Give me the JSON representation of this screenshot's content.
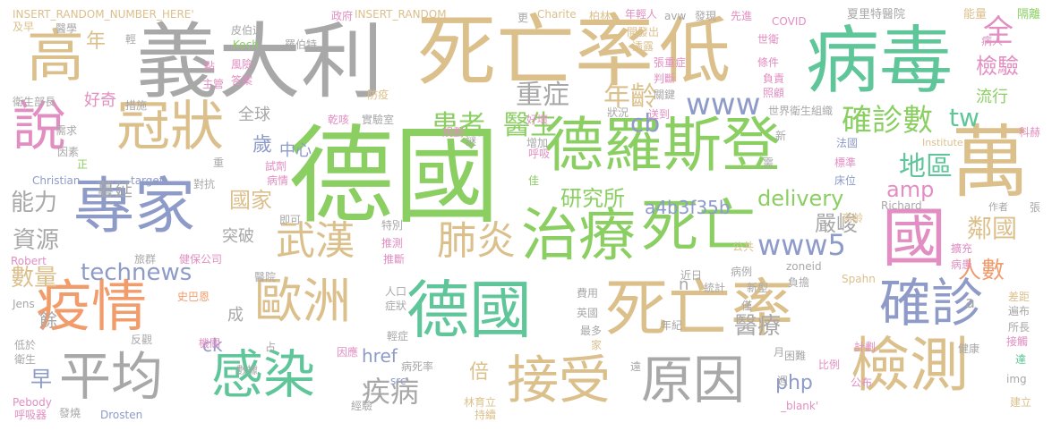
{
  "palette": {
    "green": "#8bcf63",
    "teal": "#5fc69a",
    "grey": "#a8a8a8",
    "tan": "#dcc08c",
    "pink": "#e28ec2",
    "slate": "#8e9bc9",
    "orange": "#f29b6b"
  },
  "words": [
    "德國",
    "義大利",
    "死亡率",
    "低",
    "病毒",
    "高",
    "說",
    "冠狀",
    "德羅斯登",
    "萬",
    "專家",
    "治療",
    "死亡",
    "國",
    "武漢",
    "肺炎",
    "疫情",
    "歐洲",
    "德國",
    "死亡率",
    "確診",
    "平均",
    "感染",
    "接受",
    "原因",
    "檢測",
    "technews",
    "www5",
    "delivery",
    "確診數",
    "重症",
    "年齡",
    "醫生",
    "患者",
    "www",
    "tw",
    "cb",
    "全",
    "檢驗",
    "流行",
    "地區",
    "amp",
    "鄰國",
    "人數",
    "研究所",
    "a4b3f35b",
    "國家",
    "嚴峻",
    "能力",
    "資源",
    "數量",
    "早",
    "疾病",
    "php",
    "href",
    "倍",
    "醫療",
    "ck",
    "蔓延",
    "好奇",
    "年",
    "全球",
    "歲",
    "突破",
    "中心",
    "世界衛生組織",
    "夏里特醫院",
    "能量",
    "隔離",
    "INSERT_RANDOM_NUMBER_HERE'",
    "INSERT_RANDOM_",
    "Charite",
    "政府",
    "柏林",
    "年輕人",
    "avw",
    "發現",
    "先進",
    "COVID",
    "醫學",
    "皮伯迪",
    "羅伯特",
    "Koch",
    "開發出",
    "透露",
    "世衛",
    "病人",
    "風險",
    "答案",
    "主管",
    "衛生部長",
    "措施",
    "防疫",
    "實驗室",
    "好壞",
    "狀況",
    "送到",
    "照顧",
    "負責",
    "條件",
    "判斷",
    "張重症",
    "關鍵",
    "規劃",
    "呼吸",
    "增加",
    "Institute",
    "科赫",
    "法國",
    "Christian",
    "target",
    "對抗",
    "試劑",
    "標準",
    "床位",
    "Richard",
    "作者",
    "病情",
    "即可",
    "特別",
    "推測",
    "推斷",
    "Robert",
    "旅群",
    "健保公司",
    "醫院",
    "高齡",
    "公共",
    "擴充",
    "病患",
    "zoneid",
    "Spahn",
    "病例",
    "近日",
    "統計",
    "新型",
    "費用",
    "負擔",
    "人口",
    "症狀",
    "史巴恩",
    "Jens",
    "差距",
    "遍布",
    "所長",
    "接觸",
    "英國",
    "僅",
    "年紀",
    "家",
    "最多",
    "計劃",
    "困難",
    "比例",
    "公布",
    "健康",
    "達",
    "img",
    "建立",
    "反觀",
    "機關",
    "衛生",
    "低於",
    "占",
    "因應",
    "病死率",
    "輕症",
    "遠",
    "週",
    "_blank'",
    "數據",
    "經驗",
    "林育立",
    "持續",
    "Drosten",
    "發燒",
    "呼吸器",
    "Pebody",
    "src",
    "n",
    "a",
    "成",
    "餘",
    "月",
    "謎",
    "需",
    "更",
    "及早",
    "輕",
    "重",
    "正",
    "佳",
    "乾咳",
    "點",
    "需求",
    "因素",
    "張",
    "新"
  ]
}
